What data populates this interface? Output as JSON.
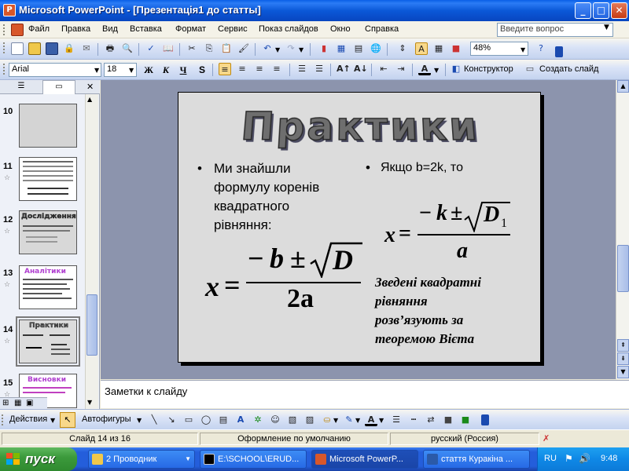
{
  "window": {
    "title": "Microsoft PowerPoint - [Презентація1 до статты]",
    "app_icon_letter": "P"
  },
  "menu": {
    "items": [
      "Файл",
      "Правка",
      "Вид",
      "Вставка",
      "Формат",
      "Сервис",
      "Показ слайдов",
      "Окно",
      "Справка"
    ],
    "ask_placeholder": "Введите вопрос"
  },
  "toolbar_standard": {
    "zoom": "48%"
  },
  "toolbar_format": {
    "font": "Arial",
    "size": "18",
    "bold": "Ж",
    "italic": "К",
    "underline": "Ч",
    "shadow": "S",
    "designer": "Конструктор",
    "new_slide": "Создать слайд"
  },
  "thumbnails": [
    {
      "num": "10"
    },
    {
      "num": "11"
    },
    {
      "num": "12",
      "title": "Дослідження"
    },
    {
      "num": "13",
      "title": "Аналітики"
    },
    {
      "num": "14",
      "title": "Практики"
    },
    {
      "num": "15",
      "title": "Висновки"
    }
  ],
  "slide": {
    "title": "Практики",
    "bullet_left": "Ми знайшли формулу коренів квадратного рівняння:",
    "bullet_right": "Якщо b=2k, то",
    "note_lines": [
      "Зведені квадратні",
      "рівняння",
      "розв’язують за",
      "теоремою Вієта"
    ],
    "formula1": {
      "lhs": "x",
      "equals": "=",
      "numerator_sign": "−",
      "numerator_var": "b",
      "pm": "±",
      "radicand": "D",
      "denominator": "2a"
    },
    "formula2": {
      "lhs": "x",
      "equals": "=",
      "numerator_sign": "−",
      "numerator_var": "k",
      "pm": "±",
      "radicand": "D",
      "subscript": "1",
      "denominator": "a"
    }
  },
  "notes": {
    "placeholder": "Заметки к слайду"
  },
  "drawing_toolbar": {
    "actions": "Действия",
    "autoshapes": "Автофигуры"
  },
  "status": {
    "slide": "Слайд 14 из 16",
    "design": "Оформление по умолчанию",
    "language": "русский (Россия)"
  },
  "taskbar": {
    "start": "пуск",
    "buttons": [
      "2 Проводник",
      "E:\\SCHOOL\\ERUD...",
      "Microsoft PowerP...",
      "стаття Куракіна ..."
    ],
    "lang": "RU",
    "time": "9:48"
  },
  "colors": {
    "titlebar": "#0a5fe6",
    "slide_bg": "#dcdcdc",
    "workspace": "#8c94ad",
    "wordart": "#6e6e6e"
  }
}
